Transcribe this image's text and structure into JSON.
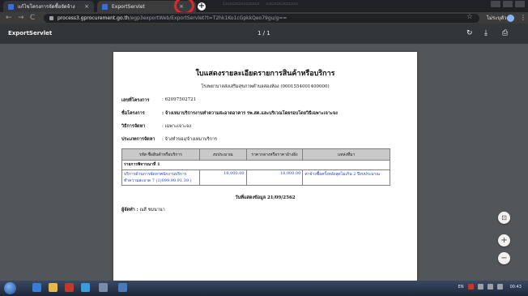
{
  "browser": {
    "tabs": [
      {
        "title": "แก้ไขโครงการจัดซื้อจัดจ้าง",
        "favicon_color": "#3b6fd6"
      },
      {
        "title": "ExportServlet",
        "favicon_color": "#3b6fd6"
      }
    ],
    "close_glyph": "×",
    "new_tab_glyph": "+",
    "back_glyph": "←",
    "forward_glyph": "→",
    "reload_glyph": "C",
    "url_host": "process3.gprocurement.go.th",
    "url_path": "/egp3exportWeb/ExportServlet?t=T2hk1Ko1cGpkkQeo79gu/g==",
    "star_glyph": "☆",
    "profile_name": "ไม่ระบุตัวตน",
    "menu_glyph": "⋮"
  },
  "pdf_viewer": {
    "title": "ExportServlet",
    "page_count": "1 / 1",
    "rotate_glyph": "↻",
    "download_glyph": "⤓",
    "print_glyph": "⎙",
    "fit_glyph": "⊡",
    "zoom_in_glyph": "+",
    "zoom_out_glyph": "−"
  },
  "document": {
    "title": "ใบแสดงรายละเอียดรายการสินค้าหรือบริการ",
    "subtitle": "โรงพยาบาลส่งเสริมสุขภาพตำบลสองห้อง (0001554001400000)",
    "fields": [
      {
        "label": "เลขที่โครงการ",
        "value": ": 62097502721",
        "bold_value": false
      },
      {
        "label": "ชื่อโครงการ",
        "value": ": จ้างเหมาบริการงานทำความสะอาดอาคาร รพ.สต.และบริเวณโดยรอบโดยวิธีเฉพาะเจาะจง",
        "bold_value": true
      },
      {
        "label": "วิธีการจัดหา",
        "value": ": เฉพาะเจาะจง",
        "bold_value": false
      },
      {
        "label": "ประเภทการจัดหา",
        "value": ": จ้างทำของ/จ้างเหมาบริการ",
        "bold_value": false
      }
    ],
    "table": {
      "headers": [
        "รหัส-ชื่อสินค้าหรือบริการ",
        "งบประมาณ",
        "ราคากลางหรือราคาอ้างอิง",
        "แหล่งที่มา"
      ],
      "group_label": "รายการพิจารณาที่ 1",
      "rows": [
        {
          "item": "บริการด้านการจัดหาพนักงานบริการทำความสะอาด 7 (1)099.99.91.39 )",
          "budget": "18,000.00",
          "reference_price": "18,000.00",
          "source": "ค่าจ้างซื้อครั้งหลังสุดไม่เกิน 2 ปีงบประมาณ"
        }
      ]
    },
    "update_date": "วันที่แสดงข้อมูล 21/09/2562",
    "maker_label": "ผู้จัดทำ :",
    "maker_name": "ณสี ชมนานา"
  },
  "taskbar": {
    "language": "EN",
    "clock": "00:43"
  },
  "colors": {
    "annotation_ring": "#e3262a",
    "link_blue": "#1a3ce0"
  }
}
